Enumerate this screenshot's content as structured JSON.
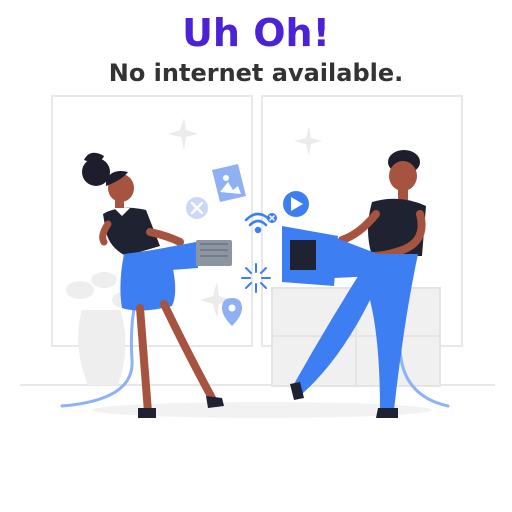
{
  "header": {
    "title": "Uh Oh!",
    "subtitle": "No internet available."
  },
  "colors": {
    "title": "#4b22d6",
    "subtitle": "#333333",
    "accent_blue": "#3d7ef2",
    "cable_blue": "#8db2f5",
    "skin": "#a6533f",
    "hair": "#1d1d2b",
    "shirt_dark": "#1f2230",
    "background_line": "#e6e6e6"
  },
  "illustration": {
    "icons": [
      "close-icon",
      "image-file-icon",
      "wifi-off-icon",
      "play-icon",
      "location-pin-icon",
      "spark-icon"
    ]
  }
}
